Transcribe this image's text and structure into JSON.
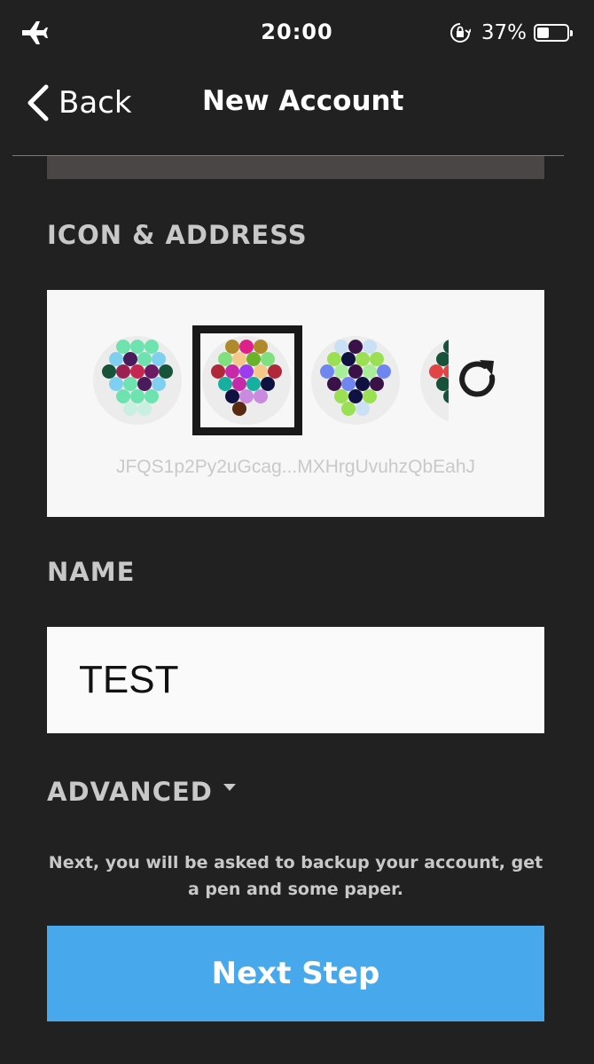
{
  "status_bar": {
    "time": "20:00",
    "battery_percent": "37%",
    "battery_level": 0.37,
    "icons": [
      "airplane-icon",
      "rotation-lock-icon",
      "battery-icon"
    ]
  },
  "nav": {
    "back_label": "Back",
    "title": "New Account"
  },
  "icon_section": {
    "label": "ICON & ADDRESS",
    "address": "JFQS1p2Py2uGcag...MXHrgUvuhzQbEahJ",
    "selected_index": 1,
    "refresh_icon": "refresh-icon"
  },
  "name_section": {
    "label": "NAME",
    "value": "TEST"
  },
  "advanced": {
    "label": "ADVANCED"
  },
  "info_text": "Next, you will be asked to backup your account, get a pen and some paper.",
  "next_button": {
    "label": "Next Step"
  },
  "colors": {
    "background": "#212121",
    "accent": "#47a9ec",
    "card": "#f7f7f7"
  }
}
